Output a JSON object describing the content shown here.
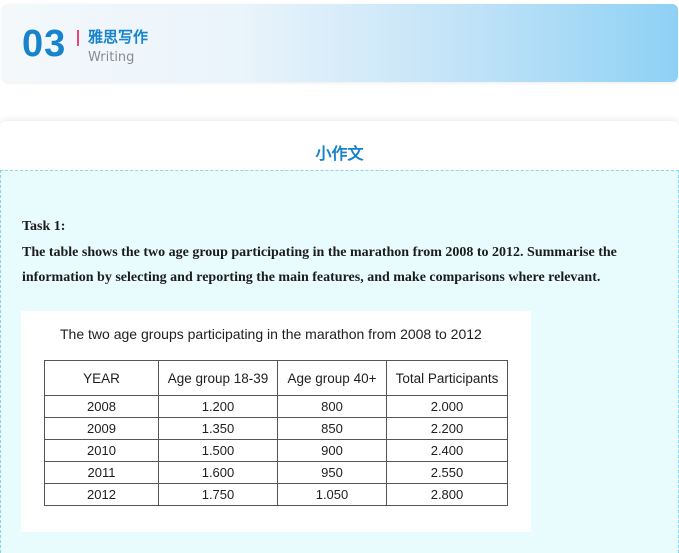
{
  "header": {
    "number": "03",
    "title_zh": "雅思写作",
    "title_en": "Writing"
  },
  "section": {
    "title": "小作文"
  },
  "task": {
    "label": "Task 1:",
    "text": "The table shows the two age group participating in the marathon from 2008 to 2012. Summarise the information by selecting and reporting the main features, and make comparisons where relevant."
  },
  "chart_data": {
    "type": "table",
    "title": "The two age groups participating in the marathon from 2008 to 2012",
    "columns": [
      "YEAR",
      "Age group 18-39",
      "Age group 40+",
      "Total Participants"
    ],
    "rows": [
      [
        "2008",
        "1.200",
        "800",
        "2.000"
      ],
      [
        "2009",
        "1.350",
        "850",
        "2.200"
      ],
      [
        "2010",
        "1.500",
        "900",
        "2.400"
      ],
      [
        "2011",
        "1.600",
        "950",
        "2.550"
      ],
      [
        "2012",
        "1.750",
        "1.050",
        "2.800"
      ]
    ]
  },
  "colors": {
    "accent": "#1683cc",
    "divider": "#e8457a",
    "content_background": "#e8fcfd"
  }
}
